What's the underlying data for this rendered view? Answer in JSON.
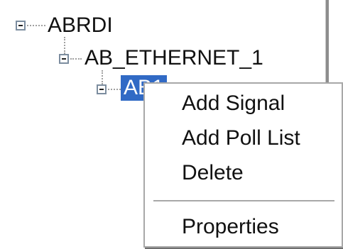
{
  "tree": {
    "nodes": [
      {
        "label": "ABRDI",
        "expander": "collapse-minus"
      },
      {
        "label": "AB_ETHERNET_1",
        "expander": "collapse-minus"
      },
      {
        "label": "AB1",
        "expander": "collapse-minus",
        "selected": true
      }
    ]
  },
  "context_menu": {
    "items": [
      {
        "label": "Add Signal"
      },
      {
        "label": "Add Poll List"
      },
      {
        "label": "Delete"
      },
      {
        "label": "Properties"
      }
    ]
  },
  "colors": {
    "selection": "#316ac5",
    "menu_border": "#a8a8a8",
    "expander_border": "#7c8d9f"
  }
}
